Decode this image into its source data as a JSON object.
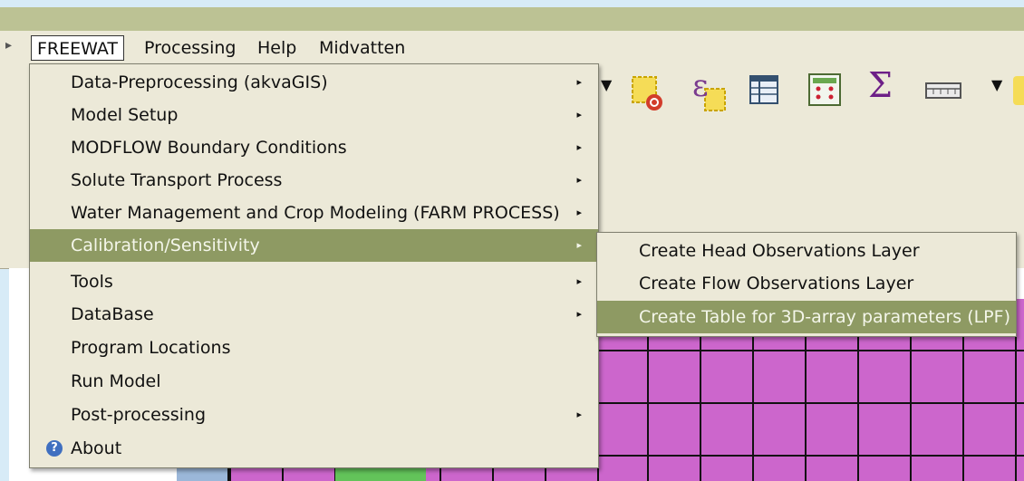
{
  "menubar": {
    "items": [
      "FREEWAT",
      "Processing",
      "Help",
      "Midvatten"
    ]
  },
  "main_menu": {
    "items": [
      {
        "label": "Data-Preprocessing (akvaGIS)",
        "submenu": true
      },
      {
        "label": "Model Setup",
        "submenu": true
      },
      {
        "label": "MODFLOW Boundary Conditions",
        "submenu": true
      },
      {
        "label": "Solute Transport Process",
        "submenu": true
      },
      {
        "label": "Water Management and Crop Modeling (FARM PROCESS)",
        "submenu": true
      },
      {
        "label": "Calibration/Sensitivity",
        "submenu": true,
        "highlighted": true
      },
      {
        "label": "Tools",
        "submenu": true
      },
      {
        "label": "DataBase",
        "submenu": true
      },
      {
        "label": "Program Locations",
        "submenu": false
      },
      {
        "label": "Run Model",
        "submenu": false
      },
      {
        "label": "Post-processing",
        "submenu": true
      },
      {
        "label": "About",
        "submenu": false,
        "icon": "info-icon"
      }
    ]
  },
  "sub_menu": {
    "items": [
      {
        "label": "Create Head Observations Layer"
      },
      {
        "label": "Create Flow Observations Layer"
      },
      {
        "label": "Create Table for 3D-array parameters (LPF)",
        "highlighted": true
      }
    ]
  },
  "toolbar_icons": [
    "dropdown-arrow-icon",
    "remove-selection-icon",
    "epsilon-icon",
    "attribute-table-icon",
    "field-calculator-icon",
    "sum-icon",
    "measure-icon",
    "dropdown-arrow-icon"
  ],
  "colors": {
    "menu_bg": "#ece9d8",
    "highlight": "#8e9a63",
    "grid_fill": "#cc66cc",
    "title_strip": "#bcc294"
  }
}
